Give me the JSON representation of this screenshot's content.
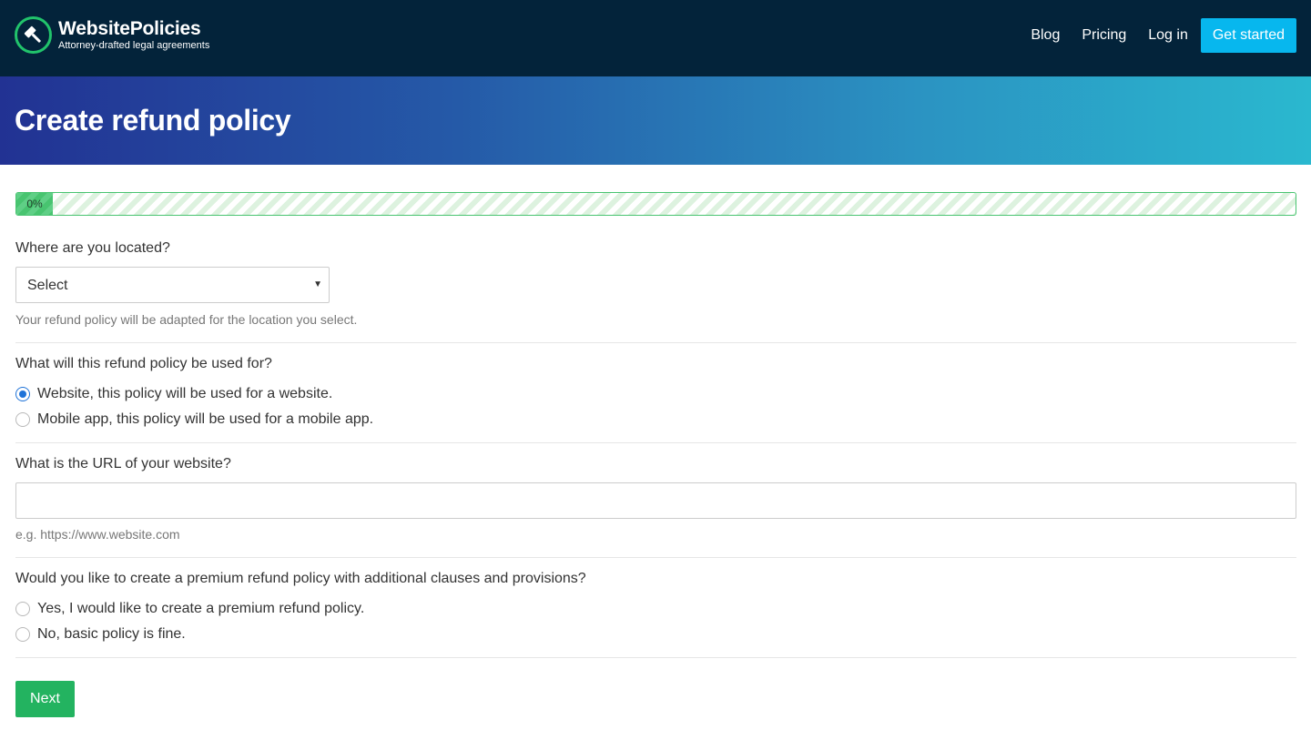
{
  "header": {
    "brand_name": "WebsitePolicies",
    "brand_tagline": "Attorney-drafted legal agreements",
    "nav": {
      "blog": "Blog",
      "pricing": "Pricing",
      "login": "Log in",
      "cta": "Get started"
    }
  },
  "banner": {
    "title": "Create refund policy"
  },
  "progress": {
    "percent": 0,
    "label": "0%"
  },
  "form": {
    "location": {
      "question": "Where are you located?",
      "selected": "Select",
      "help": "Your refund policy will be adapted for the location you select."
    },
    "usage": {
      "question": "What will this refund policy be used for?",
      "options": [
        {
          "label": "Website, this policy will be used for a website.",
          "checked": true
        },
        {
          "label": "Mobile app, this policy will be used for a mobile app.",
          "checked": false
        }
      ]
    },
    "url": {
      "question": "What is the URL of your website?",
      "value": "",
      "help": "e.g. https://www.website.com"
    },
    "premium": {
      "question": "Would you like to create a premium refund policy with additional clauses and provisions?",
      "options": [
        {
          "label": "Yes, I would like to create a premium refund policy.",
          "checked": false
        },
        {
          "label": "No, basic policy is fine.",
          "checked": false
        }
      ]
    },
    "next_label": "Next"
  },
  "colors": {
    "header_bg": "#03233a",
    "brand_green": "#21c36b",
    "cta_blue": "#07b7ee",
    "banner_start": "#223293",
    "banner_end": "#2ab8cf",
    "progress_green": "#48c470",
    "radio_blue": "#1f73d8",
    "next_green": "#23b360"
  },
  "icons": {
    "logo": "gavel-icon",
    "select_arrow": "caret-down-icon"
  }
}
